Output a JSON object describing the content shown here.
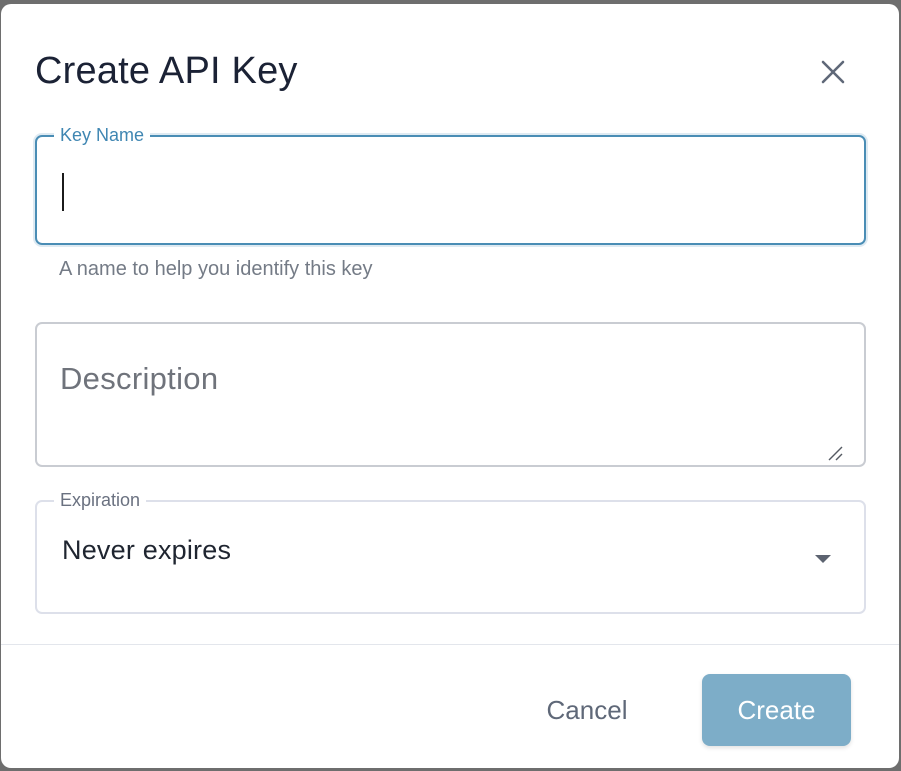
{
  "dialog": {
    "title": "Create API Key",
    "close_icon": "close-icon"
  },
  "key_name": {
    "label": "Key Name",
    "value": "",
    "helper": "A name to help you identify this key",
    "state": "focused",
    "accent_color": "#3f86b2"
  },
  "description": {
    "placeholder": "Description",
    "value": "",
    "resize_icon": "resize-handle-icon"
  },
  "expiration": {
    "label": "Expiration",
    "selected": "Never expires",
    "arrow_icon": "caret-down-icon"
  },
  "footer": {
    "cancel_label": "Cancel",
    "create_label": "Create",
    "create_color": "#7dadc8"
  }
}
